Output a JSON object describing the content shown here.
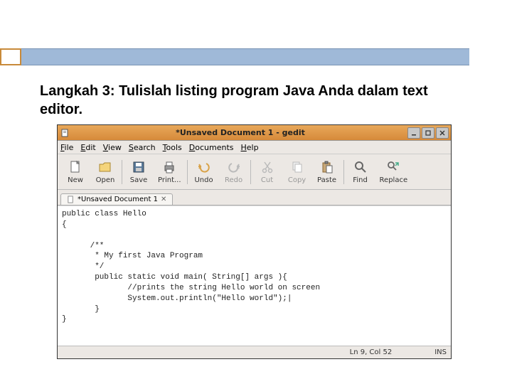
{
  "instruction": "Langkah 3: Tulislah listing program Java Anda dalam text editor.",
  "window": {
    "title": "*Unsaved Document 1 - gedit"
  },
  "menu": {
    "file": "File",
    "edit": "Edit",
    "view": "View",
    "search": "Search",
    "tools": "Tools",
    "documents": "Documents",
    "help": "Help"
  },
  "toolbar": {
    "new": "New",
    "open": "Open",
    "save": "Save",
    "print": "Print...",
    "undo": "Undo",
    "redo": "Redo",
    "cut": "Cut",
    "copy": "Copy",
    "paste": "Paste",
    "find": "Find",
    "replace": "Replace"
  },
  "tab": {
    "label": "*Unsaved Document 1"
  },
  "code": "public class Hello\n{\n\n      /**\n       * My first Java Program\n       */\n       public static void main( String[] args ){\n              //prints the string Hello world on screen\n              System.out.println(\"Hello world\");|\n       }\n}",
  "status": {
    "position": "Ln 9, Col 52",
    "ins": "INS"
  }
}
